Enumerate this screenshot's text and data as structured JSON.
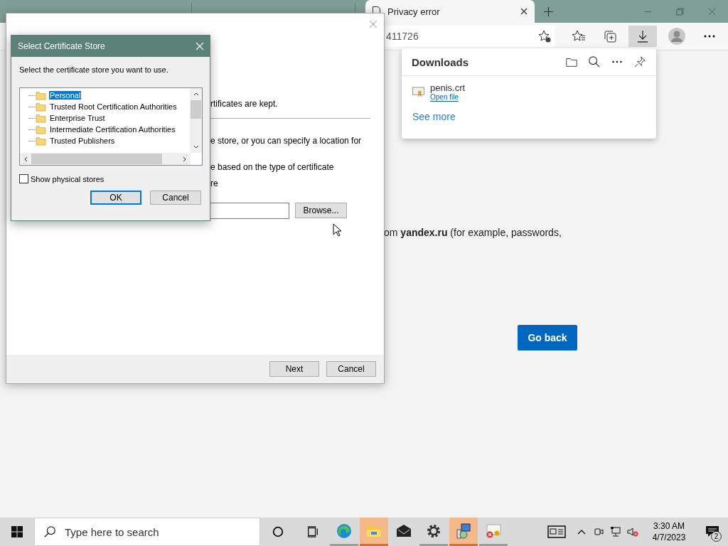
{
  "browser": {
    "tabs": [
      {
        "title": "Privacy error",
        "selected": true
      }
    ],
    "address": "411726",
    "downloads": {
      "title": "Downloads",
      "items": [
        {
          "file": "penis.crt",
          "action": "Open file"
        }
      ],
      "see_more": "See more"
    },
    "page": {
      "text": "om **yandex.ru** (for example, passwords,",
      "go_back": "Go back"
    }
  },
  "wizard": {
    "fragments": [
      "rtificates are kept.",
      "e store, or you can specify a location for",
      "e based on the type of certificate",
      "re"
    ],
    "browse": "Browse...",
    "buttons": [
      "Next",
      "Cancel"
    ]
  },
  "dialog": {
    "title": "Select Certificate Store",
    "prompt": "Select the certificate store you want to use.",
    "stores": [
      {
        "label": "Personal",
        "selected": true
      },
      {
        "label": "Trusted Root Certification Authorities",
        "selected": false
      },
      {
        "label": "Enterprise Trust",
        "selected": false
      },
      {
        "label": "Intermediate Certification Authorities",
        "selected": false
      },
      {
        "label": "Trusted Publishers",
        "selected": false
      }
    ],
    "show_physical": {
      "label": "Show physical stores",
      "checked": false
    },
    "buttons": [
      "OK",
      "Cancel"
    ]
  },
  "taskbar": {
    "search_placeholder": "Type here to search",
    "apps": [
      {
        "kind": "edge",
        "highlighted": false,
        "running": true
      },
      {
        "kind": "explorer",
        "highlighted": true,
        "running": true
      },
      {
        "kind": "mail",
        "highlighted": false,
        "running": false
      },
      {
        "kind": "settings",
        "highlighted": false,
        "running": true
      },
      {
        "kind": "certmgr",
        "highlighted": true,
        "running": true
      },
      {
        "kind": "certerror",
        "highlighted": false,
        "running": true
      }
    ],
    "time": "3:30 AM",
    "date": "4/7/2023",
    "notifications": "2"
  }
}
